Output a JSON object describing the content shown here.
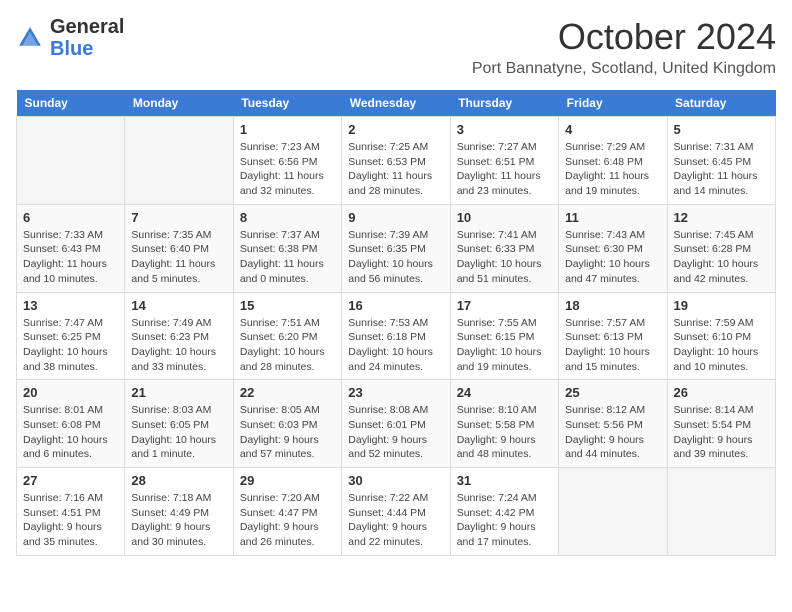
{
  "header": {
    "logo_general": "General",
    "logo_blue": "Blue",
    "month_title": "October 2024",
    "location": "Port Bannatyne, Scotland, United Kingdom"
  },
  "weekdays": [
    "Sunday",
    "Monday",
    "Tuesday",
    "Wednesday",
    "Thursday",
    "Friday",
    "Saturday"
  ],
  "weeks": [
    [
      {
        "day": "",
        "info": ""
      },
      {
        "day": "",
        "info": ""
      },
      {
        "day": "1",
        "info": "Sunrise: 7:23 AM\nSunset: 6:56 PM\nDaylight: 11 hours and 32 minutes."
      },
      {
        "day": "2",
        "info": "Sunrise: 7:25 AM\nSunset: 6:53 PM\nDaylight: 11 hours and 28 minutes."
      },
      {
        "day": "3",
        "info": "Sunrise: 7:27 AM\nSunset: 6:51 PM\nDaylight: 11 hours and 23 minutes."
      },
      {
        "day": "4",
        "info": "Sunrise: 7:29 AM\nSunset: 6:48 PM\nDaylight: 11 hours and 19 minutes."
      },
      {
        "day": "5",
        "info": "Sunrise: 7:31 AM\nSunset: 6:45 PM\nDaylight: 11 hours and 14 minutes."
      }
    ],
    [
      {
        "day": "6",
        "info": "Sunrise: 7:33 AM\nSunset: 6:43 PM\nDaylight: 11 hours and 10 minutes."
      },
      {
        "day": "7",
        "info": "Sunrise: 7:35 AM\nSunset: 6:40 PM\nDaylight: 11 hours and 5 minutes."
      },
      {
        "day": "8",
        "info": "Sunrise: 7:37 AM\nSunset: 6:38 PM\nDaylight: 11 hours and 0 minutes."
      },
      {
        "day": "9",
        "info": "Sunrise: 7:39 AM\nSunset: 6:35 PM\nDaylight: 10 hours and 56 minutes."
      },
      {
        "day": "10",
        "info": "Sunrise: 7:41 AM\nSunset: 6:33 PM\nDaylight: 10 hours and 51 minutes."
      },
      {
        "day": "11",
        "info": "Sunrise: 7:43 AM\nSunset: 6:30 PM\nDaylight: 10 hours and 47 minutes."
      },
      {
        "day": "12",
        "info": "Sunrise: 7:45 AM\nSunset: 6:28 PM\nDaylight: 10 hours and 42 minutes."
      }
    ],
    [
      {
        "day": "13",
        "info": "Sunrise: 7:47 AM\nSunset: 6:25 PM\nDaylight: 10 hours and 38 minutes."
      },
      {
        "day": "14",
        "info": "Sunrise: 7:49 AM\nSunset: 6:23 PM\nDaylight: 10 hours and 33 minutes."
      },
      {
        "day": "15",
        "info": "Sunrise: 7:51 AM\nSunset: 6:20 PM\nDaylight: 10 hours and 28 minutes."
      },
      {
        "day": "16",
        "info": "Sunrise: 7:53 AM\nSunset: 6:18 PM\nDaylight: 10 hours and 24 minutes."
      },
      {
        "day": "17",
        "info": "Sunrise: 7:55 AM\nSunset: 6:15 PM\nDaylight: 10 hours and 19 minutes."
      },
      {
        "day": "18",
        "info": "Sunrise: 7:57 AM\nSunset: 6:13 PM\nDaylight: 10 hours and 15 minutes."
      },
      {
        "day": "19",
        "info": "Sunrise: 7:59 AM\nSunset: 6:10 PM\nDaylight: 10 hours and 10 minutes."
      }
    ],
    [
      {
        "day": "20",
        "info": "Sunrise: 8:01 AM\nSunset: 6:08 PM\nDaylight: 10 hours and 6 minutes."
      },
      {
        "day": "21",
        "info": "Sunrise: 8:03 AM\nSunset: 6:05 PM\nDaylight: 10 hours and 1 minute."
      },
      {
        "day": "22",
        "info": "Sunrise: 8:05 AM\nSunset: 6:03 PM\nDaylight: 9 hours and 57 minutes."
      },
      {
        "day": "23",
        "info": "Sunrise: 8:08 AM\nSunset: 6:01 PM\nDaylight: 9 hours and 52 minutes."
      },
      {
        "day": "24",
        "info": "Sunrise: 8:10 AM\nSunset: 5:58 PM\nDaylight: 9 hours and 48 minutes."
      },
      {
        "day": "25",
        "info": "Sunrise: 8:12 AM\nSunset: 5:56 PM\nDaylight: 9 hours and 44 minutes."
      },
      {
        "day": "26",
        "info": "Sunrise: 8:14 AM\nSunset: 5:54 PM\nDaylight: 9 hours and 39 minutes."
      }
    ],
    [
      {
        "day": "27",
        "info": "Sunrise: 7:16 AM\nSunset: 4:51 PM\nDaylight: 9 hours and 35 minutes."
      },
      {
        "day": "28",
        "info": "Sunrise: 7:18 AM\nSunset: 4:49 PM\nDaylight: 9 hours and 30 minutes."
      },
      {
        "day": "29",
        "info": "Sunrise: 7:20 AM\nSunset: 4:47 PM\nDaylight: 9 hours and 26 minutes."
      },
      {
        "day": "30",
        "info": "Sunrise: 7:22 AM\nSunset: 4:44 PM\nDaylight: 9 hours and 22 minutes."
      },
      {
        "day": "31",
        "info": "Sunrise: 7:24 AM\nSunset: 4:42 PM\nDaylight: 9 hours and 17 minutes."
      },
      {
        "day": "",
        "info": ""
      },
      {
        "day": "",
        "info": ""
      }
    ]
  ]
}
